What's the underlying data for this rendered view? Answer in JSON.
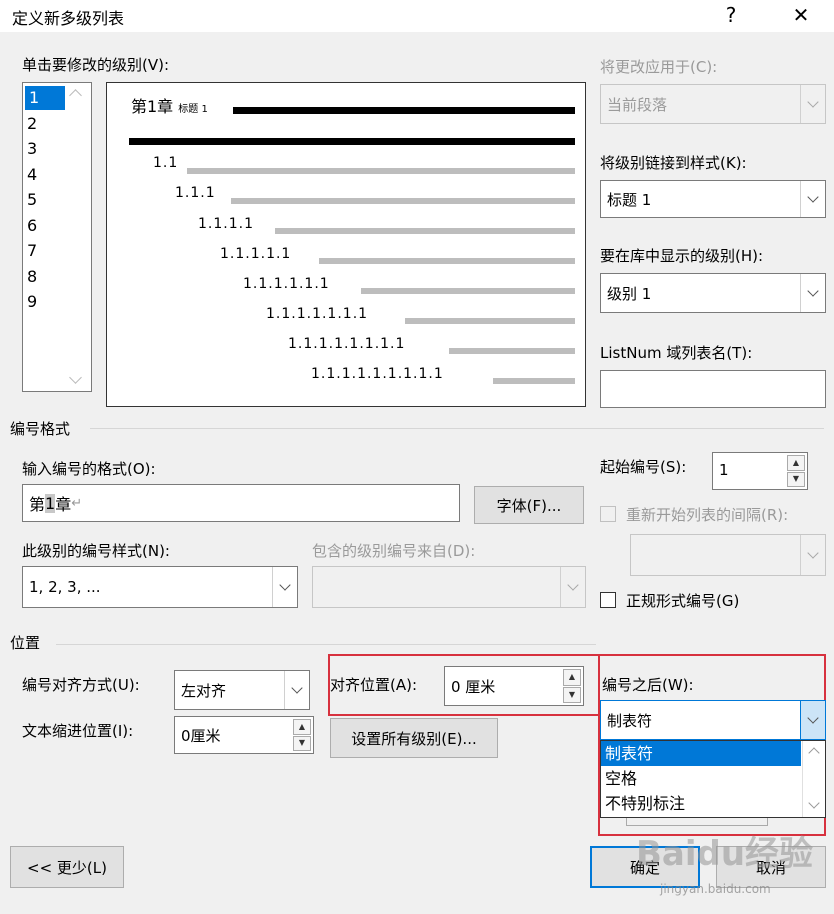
{
  "window": {
    "title": "定义新多级列表",
    "help": "?",
    "close": "✕"
  },
  "levels": {
    "label": "单击要修改的级别(V):",
    "items": [
      "1",
      "2",
      "3",
      "4",
      "5",
      "6",
      "7",
      "8",
      "9"
    ],
    "selected": "1"
  },
  "preview": {
    "first": "第1章",
    "first_caption": "标题 1",
    "rows": [
      "1.1",
      "1.1.1",
      "1.1.1.1",
      "1.1.1.1.1",
      "1.1.1.1.1.1",
      "1.1.1.1.1.1.1",
      "1.1.1.1.1.1.1.1",
      "1.1.1.1.1.1.1.1.1"
    ]
  },
  "right_panel": {
    "apply_to_label": "将更改应用于(C):",
    "apply_to_value": "当前段落",
    "link_style_label": "将级别链接到样式(K):",
    "link_style_value": "标题 1",
    "gallery_level_label": "要在库中显示的级别(H):",
    "gallery_level_value": "级别 1",
    "listnum_label": "ListNum 域列表名(T):",
    "listnum_value": ""
  },
  "number_format": {
    "section": "编号格式",
    "enter_format_label": "输入编号的格式(O):",
    "format_value_prefix": "第",
    "format_value_field": "1",
    "format_value_suffix": "章",
    "para_mark": "↵",
    "font_button": "字体(F)...",
    "style_label": "此级别的编号样式(N):",
    "style_value": "1, 2, 3, ...",
    "include_label": "包含的级别编号来自(D):",
    "include_value": "",
    "start_at_label": "起始编号(S):",
    "start_at_value": "1",
    "restart_label": "重新开始列表的间隔(R):",
    "restart_value": "",
    "legal_label": "正规形式编号(G)"
  },
  "position": {
    "section": "位置",
    "alignment_label": "编号对齐方式(U):",
    "alignment_value": "左对齐",
    "aligned_at_label": "对齐位置(A):",
    "aligned_at_value": "0 厘米",
    "indent_label": "文本缩进位置(I):",
    "indent_value": "0厘米",
    "set_all_button": "设置所有级别(E)...",
    "follow_label": "编号之后(W):",
    "follow_value": "制表符",
    "follow_options": [
      "制表符",
      "空格",
      "不特别标注"
    ]
  },
  "footer": {
    "less_button": "<< 更少(L)",
    "ok_button": "确定",
    "cancel_button": "取消"
  },
  "watermark": {
    "brand": "Baidu经验",
    "url": "jingyan.baidu.com"
  }
}
